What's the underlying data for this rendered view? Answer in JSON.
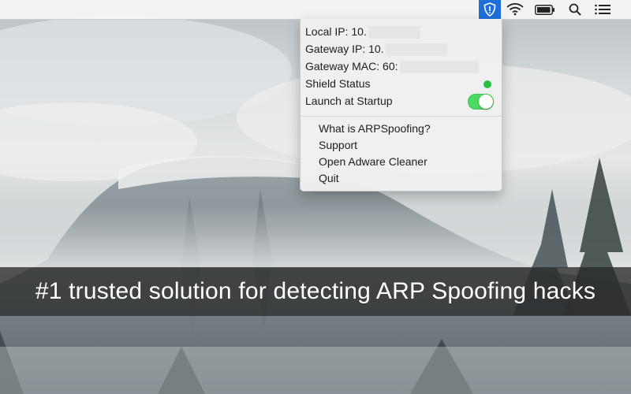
{
  "menubar": {
    "icons": [
      "shield-icon",
      "wifi-icon",
      "battery-icon",
      "search-icon",
      "list-icon"
    ],
    "accent": "#1f6fdb"
  },
  "dropdown": {
    "local_ip_label": "Local IP: 10.",
    "gateway_ip_label": "Gateway IP: 10.",
    "gateway_mac_label": "Gateway MAC: 60:",
    "shield_status_label": "Shield Status",
    "shield_status_color": "#29c141",
    "launch_label": "Launch at Startup",
    "launch_enabled": true,
    "items": [
      {
        "label": "What is ARPSpoofing?"
      },
      {
        "label": "Support"
      },
      {
        "label": "Open Adware Cleaner"
      },
      {
        "label": "Quit"
      }
    ]
  },
  "banner": {
    "text": "#1 trusted solution for detecting ARP Spoofing hacks"
  }
}
